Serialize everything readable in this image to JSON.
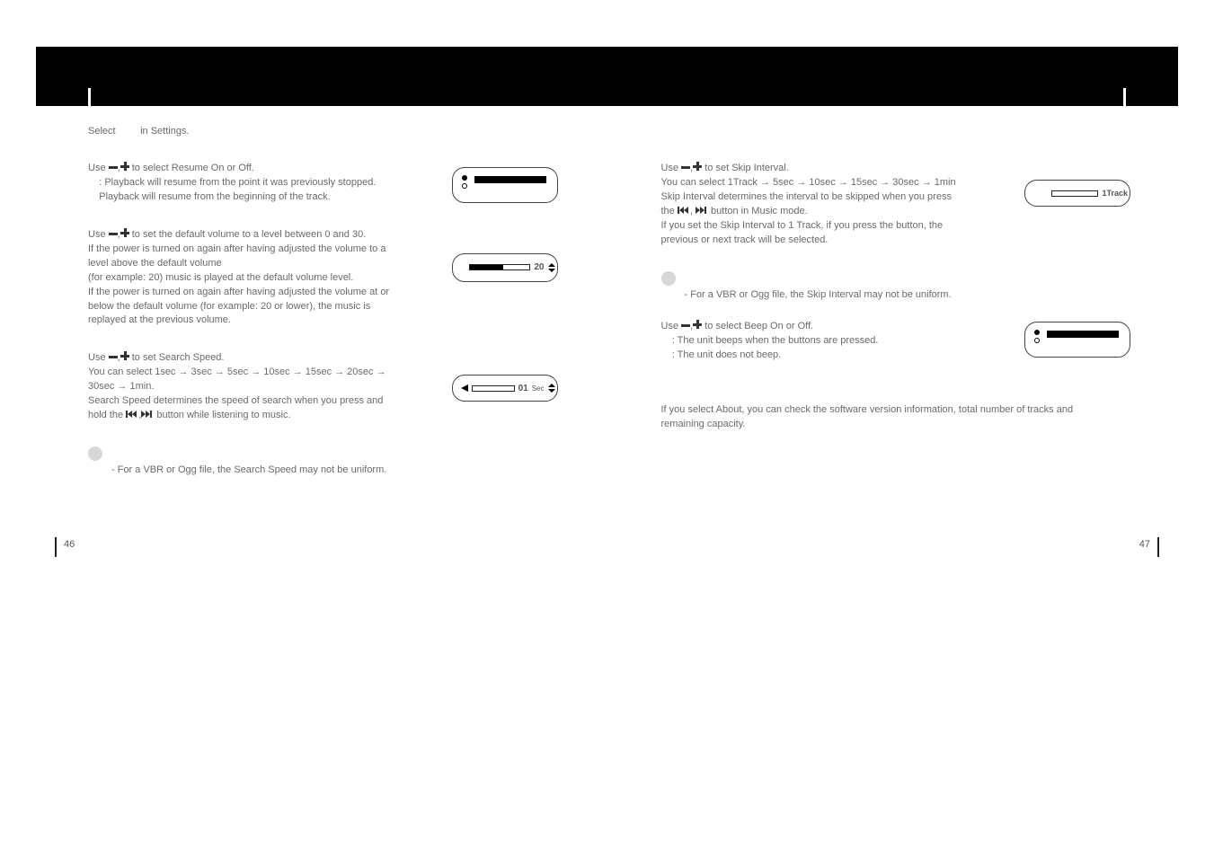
{
  "header": {
    "select_prefix": "Select",
    "select_suffix": "in Settings."
  },
  "left": {
    "resume": {
      "line1_pre": "Use",
      "line1_post": "to select Resume On or Off.",
      "line2": ": Playback will resume from the point it was previously stopped.",
      "line3": "Playback will resume from the beginning of the track."
    },
    "default_vol": {
      "line1_pre": "Use",
      "line1_post": "to set the default volume to a level between 0 and 30.",
      "line2": "If the power is turned on again after having adjusted the volume to a level above the default volume",
      "line3": "(for example: 20) music is played at the default volume level.",
      "line4": "If the power is turned on again after having adjusted the volume at or below the default volume (for example: 20 or lower), the music is replayed at the previous volume.",
      "lcd_value": "20"
    },
    "search_speed": {
      "line1_pre": "Use",
      "line1_post": "to set Search Speed.",
      "line2": "You can select 1sec → 3sec → 5sec → 10sec → 15sec → 20sec → 30sec → 1min.",
      "line3_pre": "Search Speed determines the speed of search when you press and hold the",
      "line3_post": "button while listening to music.",
      "lcd_value": "01",
      "lcd_unit": "Sec"
    },
    "notice": "- For a VBR or Ogg file, the Search Speed may not be uniform."
  },
  "right": {
    "skip": {
      "line1_pre": "Use",
      "line1_post": "to set Skip Interval.",
      "line2": "You can select 1Track → 5sec → 10sec → 15sec → 30sec → 1min",
      "line3_pre": "Skip Interval determines the interval to be skipped when you press the",
      "line3_post": "button in Music mode.",
      "line4": "If you set the Skip Interval to 1 Track, if you press the button, the previous or next track will be selected.",
      "lcd_value": "1Track"
    },
    "skip_notice": "- For a VBR or Ogg file, the Skip Interval may not be uniform.",
    "beep": {
      "line1_pre": "Use",
      "line1_post": "to select Beep On or Off.",
      "line2": ": The unit beeps when the buttons are pressed.",
      "line3": ": The unit does not beep."
    },
    "about": "If you select About, you can check the software version information, total number of tracks and remaining capacity."
  },
  "pages": {
    "left": "46",
    "right": "47"
  }
}
